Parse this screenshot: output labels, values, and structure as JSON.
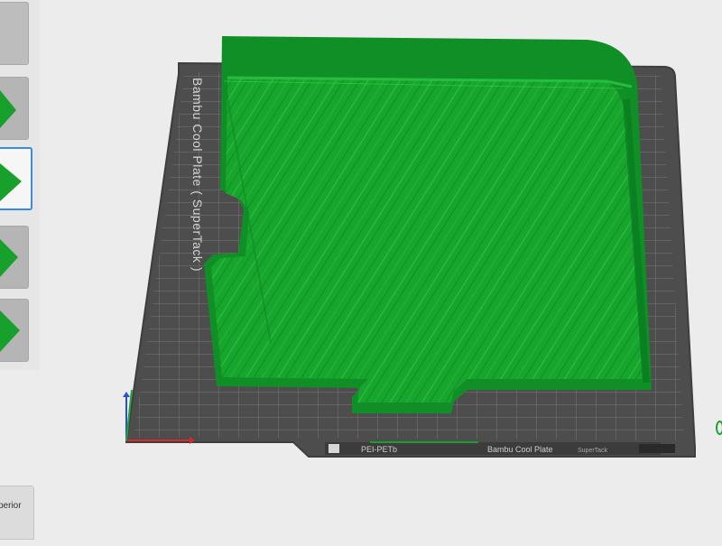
{
  "viewport": {
    "plate_name_vertical": "Bambu Cool Plate ( SuperTack )",
    "plate_name_label": "Bambu Cool Plate",
    "plate_sub_label": "SuperTack",
    "brand_label": "PEI-PETb",
    "model_color": "#13a12c",
    "plate_color": "#5a5a5a"
  },
  "sidebar": {
    "thumbnails": [
      {
        "name": "plate-thumbnail-1",
        "selected": false
      },
      {
        "name": "plate-thumbnail-2",
        "selected": false
      },
      {
        "name": "plate-thumbnail-3",
        "selected": true
      },
      {
        "name": "plate-thumbnail-4",
        "selected": false
      },
      {
        "name": "plate-thumbnail-5",
        "selected": false
      }
    ],
    "quality_label": "perior"
  }
}
